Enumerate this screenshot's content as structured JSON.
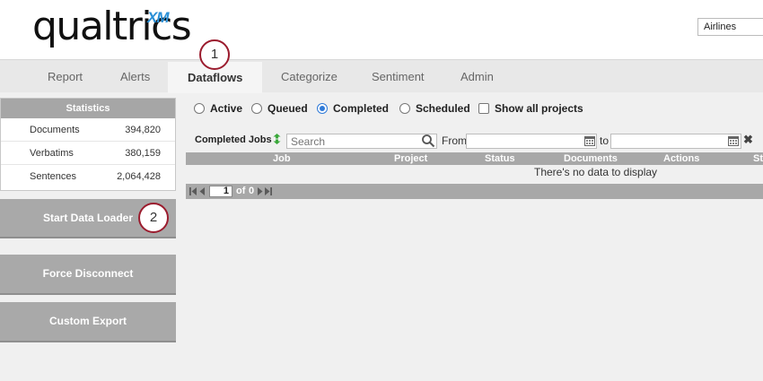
{
  "header": {
    "logo_text": "qualtrics",
    "logo_suffix": "XM",
    "project_selected": "Airlines"
  },
  "tabs": [
    {
      "label": "Report"
    },
    {
      "label": "Alerts"
    },
    {
      "label": "Dataflows",
      "active": true
    },
    {
      "label": "Categorize"
    },
    {
      "label": "Sentiment"
    },
    {
      "label": "Admin"
    }
  ],
  "callouts": [
    "1",
    "2"
  ],
  "statistics": {
    "title": "Statistics",
    "rows": [
      {
        "label": "Documents",
        "value": "394,820"
      },
      {
        "label": "Verbatims",
        "value": "380,159"
      },
      {
        "label": "Sentences",
        "value": "2,064,428"
      }
    ]
  },
  "panel_buttons": {
    "start_data_loader": "Start Data Loader",
    "force_disconnect": "Force Disconnect",
    "custom_export": "Custom Export"
  },
  "filters": {
    "active": "Active",
    "queued": "Queued",
    "completed": "Completed",
    "scheduled": "Scheduled",
    "show_all": "Show all projects",
    "selected": "Completed"
  },
  "toolbar": {
    "jobs_label": "Completed Jobs",
    "search_placeholder": "Search",
    "from_label": "From",
    "to_label": "to"
  },
  "grid": {
    "columns": [
      "Job",
      "Project",
      "Status",
      "Documents",
      "Actions",
      "St"
    ],
    "empty_message": "There's no data to display"
  },
  "pager": {
    "page": "1",
    "of_label": "of",
    "total": "0"
  },
  "colors": {
    "accent": "#2f7ad8",
    "callout_border": "#9b1c2e",
    "panel_gray": "#a9a9a9",
    "logo_xm": "#2a8fd6"
  }
}
